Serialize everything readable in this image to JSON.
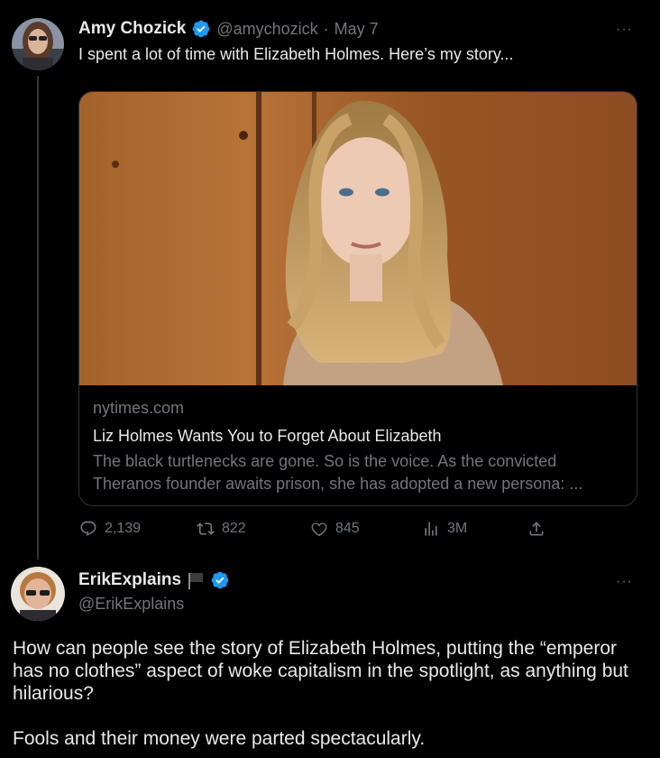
{
  "colors": {
    "background": "#000000",
    "text": "#e7e9ea",
    "muted": "#71767b",
    "verified": "#1d9bf0",
    "border": "#2f3336"
  },
  "tweet1": {
    "name": "Amy Chozick",
    "verified_icon": "verified-badge-icon",
    "handle": "@amychozick",
    "separator": "·",
    "date": "May 7",
    "text": "I spent a lot of time with Elizabeth Holmes. Here’s my story...",
    "more": "···",
    "card": {
      "domain": "nytimes.com",
      "title": "Liz Holmes Wants You to Forget About Elizabeth",
      "description": "The black turtlenecks are gone. So is the voice. As the convicted Theranos founder awaits prison, she has adopted a new persona: ..."
    },
    "actions": {
      "replies": "2,139",
      "retweets": "822",
      "likes": "845",
      "views": "3M"
    }
  },
  "tweet2": {
    "name": "ErikExplains",
    "flag_icon": "flag-icon",
    "verified_icon": "verified-badge-icon",
    "handle": "@ErikExplains",
    "more": "···",
    "text": "How can people see the story of Elizabeth Holmes, putting the “emperor has no clothes” aspect of woke capitalism in the spotlight, as anything but hilarious?\n\nFools and their money were parted spectacularly."
  }
}
